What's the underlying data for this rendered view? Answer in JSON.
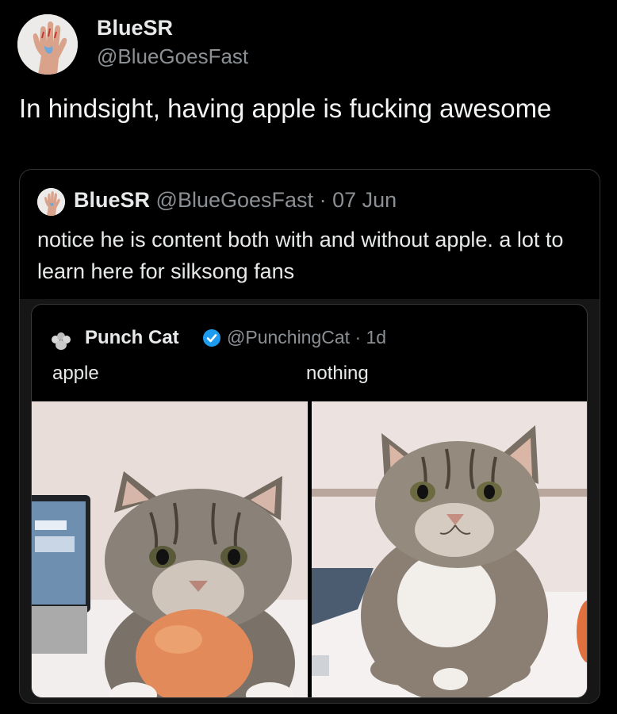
{
  "tweet": {
    "author_name": "BlueSR",
    "author_handle": "@BlueGoesFast",
    "text": "In hindsight, having apple is fucking awesome"
  },
  "quote": {
    "author_name": "BlueSR",
    "author_handle": "@BlueGoesFast",
    "separator": "·",
    "date": "07 Jun",
    "text": "notice he is content both with and without apple. a lot to learn here for silksong fans"
  },
  "embedded": {
    "author_name": "Punch Cat",
    "author_handle": "@PunchingCat · 1d",
    "caption_left": "apple",
    "caption_right": "nothing"
  },
  "colors": {
    "background": "#000000",
    "primary_text": "#e7e9ea",
    "secondary_text": "#8b9095",
    "verified_badge": "#1d9bf0",
    "card_border": "#2f3336"
  },
  "icons": {
    "avatar_main": "hand-avatar",
    "avatar_quote": "hand-avatar",
    "avatar_embedded": "paw-avatar",
    "verified": "verified-badge-icon"
  }
}
